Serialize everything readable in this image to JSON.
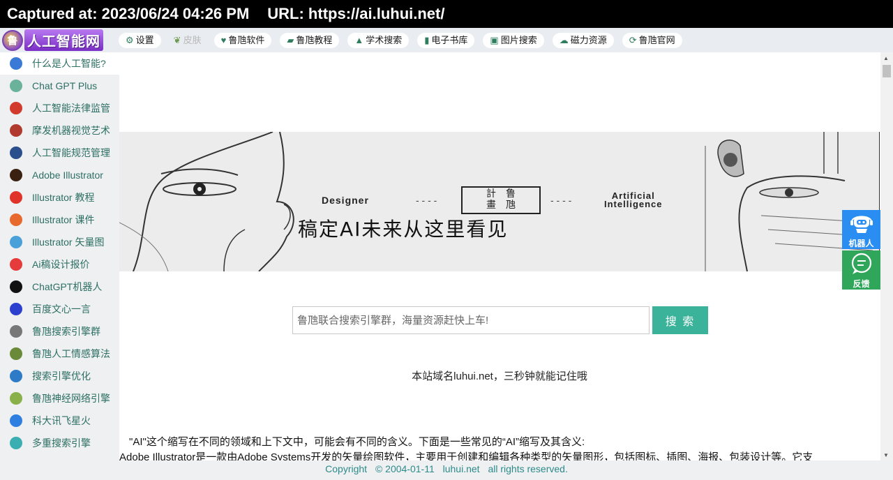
{
  "capture": {
    "captured_at": "Captured at: 2023/06/24 04:26 PM",
    "url": "URL: https://ai.luhui.net/"
  },
  "logo": {
    "mark": "鲁",
    "text": "人工智能网"
  },
  "topnav": [
    {
      "icon": "gear-icon",
      "label": "设置"
    },
    {
      "icon": "leaf-icon",
      "label": "皮肤"
    },
    {
      "icon": "heart-icon",
      "label": "鲁虺软件"
    },
    {
      "icon": "book-open-icon",
      "label": "鲁虺教程"
    },
    {
      "icon": "graduation-cap-icon",
      "label": "学术搜索"
    },
    {
      "icon": "book-icon",
      "label": "电子书库"
    },
    {
      "icon": "image-icon",
      "label": "图片搜索"
    },
    {
      "icon": "cloud-download-icon",
      "label": "磁力资源"
    },
    {
      "icon": "refresh-icon",
      "label": "鲁虺官网"
    }
  ],
  "sidebar": [
    {
      "label": "什么是人工智能?",
      "icon": "ai-robot-icon",
      "color": "#3a7ad6"
    },
    {
      "label": "Chat GPT Plus",
      "icon": "openai-icon",
      "color": "#6ab39a"
    },
    {
      "label": "人工智能法律监管",
      "icon": "law-icon",
      "color": "#d23b2b"
    },
    {
      "label": "摩发机器视觉艺术",
      "icon": "vision-art-icon",
      "color": "#b03a2e"
    },
    {
      "label": "人工智能规范管理",
      "icon": "cac-icon",
      "color": "#2b4f8c"
    },
    {
      "label": "Adobe Illustrator",
      "icon": "illustrator-icon",
      "color": "#3a2010"
    },
    {
      "label": "Illustrator 教程",
      "icon": "adobe-icon",
      "color": "#e0342a"
    },
    {
      "label": "Illustrator 课件",
      "icon": "courseware-icon",
      "color": "#e8692d"
    },
    {
      "label": "Illustrator 矢量图",
      "icon": "layers-icon",
      "color": "#4aa0d8"
    },
    {
      "label": "Ai稿设计报价",
      "icon": "quote-icon",
      "color": "#e63b3b"
    },
    {
      "label": "ChatGPT机器人",
      "icon": "chatgpt-icon",
      "color": "#111111"
    },
    {
      "label": "百度文心一言",
      "icon": "baidu-icon",
      "color": "#2d3fcf"
    },
    {
      "label": "鲁虺搜索引擎群",
      "icon": "search-icon",
      "color": "#777777"
    },
    {
      "label": "鲁虺人工情感算法",
      "icon": "emotion-icon",
      "color": "#6a8a3a"
    },
    {
      "label": "搜索引擎优化",
      "icon": "globe-icon",
      "color": "#2d7ac6"
    },
    {
      "label": "鲁虺神经网络引擎",
      "icon": "neural-network-icon",
      "color": "#8ab04a"
    },
    {
      "label": "科大讯飞星火",
      "icon": "spark-icon",
      "color": "#2f7fe0"
    },
    {
      "label": "多重搜索引擎",
      "icon": "multi-search-icon",
      "color": "#3aaeb0"
    }
  ],
  "banner": {
    "left_caption": "Designer",
    "seal_top": "計　鲁",
    "seal_bottom": "畫　虺",
    "right_caption_1": "Artificial",
    "right_caption_2": "Intelligence",
    "headline": "稿定AI未来从这里看见"
  },
  "search": {
    "placeholder": "鲁虺联合搜索引擎群，海量资源赶快上车!",
    "button": "搜 索"
  },
  "domain_note": "本站域名luhui.net，三秒钟就能记住哦",
  "article": {
    "line1": "\"AI\"这个缩写在不同的领域和上下文中，可能会有不同的含义。下面是一些常见的“AI”缩写及其含义:",
    "line2": "Adobe Illustrator是一款由Adobe Systems开发的矢量绘图软件，主要用于创建和编辑各种类型的矢量图形，包括图标、插图、海报、包装设计等。它支"
  },
  "footer": {
    "copyright": "Copyright",
    "years": "© 2004-01-11",
    "domain": "luhui.net",
    "rights": "all rights reserved."
  },
  "floating": {
    "robot_label": "机器人",
    "feedback_label": "反馈"
  }
}
